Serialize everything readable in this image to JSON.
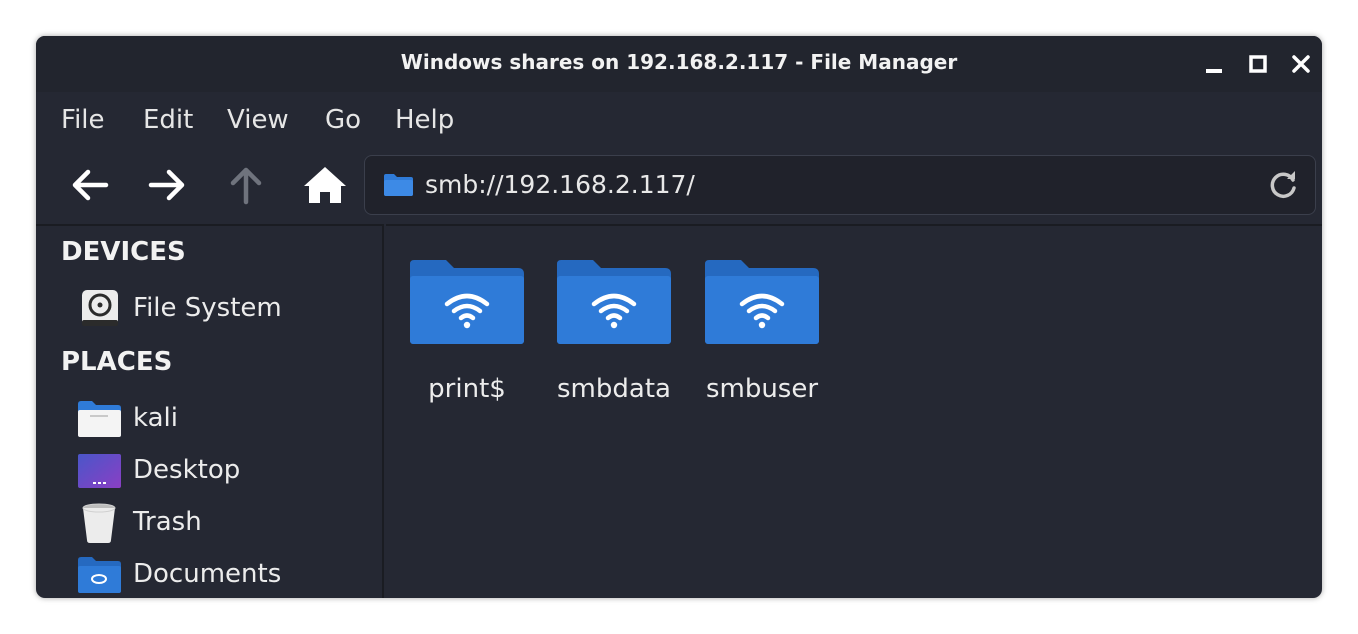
{
  "window": {
    "title": "Windows shares on 192.168.2.117 - File Manager"
  },
  "menu": {
    "items": [
      "File",
      "Edit",
      "View",
      "Go",
      "Help"
    ]
  },
  "toolbar": {
    "back_icon": "arrow-left-icon",
    "forward_icon": "arrow-right-icon",
    "up_icon": "arrow-up-icon",
    "home_icon": "home-icon",
    "location": "smb://192.168.2.117/",
    "reload_icon": "reload-icon"
  },
  "sidebar": {
    "devices_title": "DEVICES",
    "devices": [
      {
        "label": "File System",
        "icon": "drive-icon"
      }
    ],
    "places_title": "PLACES",
    "places": [
      {
        "label": "kali",
        "icon": "home-folder-icon"
      },
      {
        "label": "Desktop",
        "icon": "desktop-icon"
      },
      {
        "label": "Trash",
        "icon": "trash-icon"
      },
      {
        "label": "Documents",
        "icon": "documents-folder-icon"
      }
    ]
  },
  "shares": [
    {
      "name": "print$",
      "icon": "network-folder-icon"
    },
    {
      "name": "smbdata",
      "icon": "network-folder-icon"
    },
    {
      "name": "smbuser",
      "icon": "network-folder-icon"
    }
  ],
  "colors": {
    "window_bg": "#252833",
    "folder_blue": "#2f7bd8",
    "folder_blue_dark": "#2569c0"
  }
}
